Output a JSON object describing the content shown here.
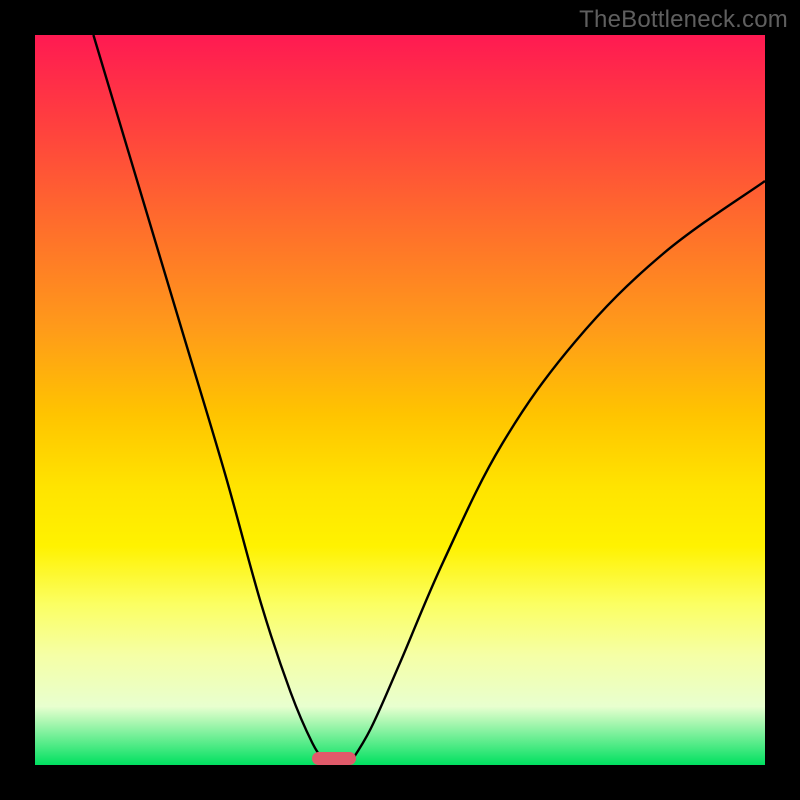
{
  "watermark": "TheBottleneck.com",
  "chart_data": {
    "type": "line",
    "title": "",
    "xlabel": "",
    "ylabel": "",
    "xlim": [
      0,
      100
    ],
    "ylim": [
      0,
      100
    ],
    "grid": false,
    "legend": false,
    "series": [
      {
        "name": "left-branch",
        "x": [
          8,
          14,
          20,
          26,
          31,
          35,
          38,
          40
        ],
        "y": [
          100,
          80,
          60,
          40,
          22,
          10,
          3,
          0
        ]
      },
      {
        "name": "right-branch",
        "x": [
          43,
          46,
          50,
          56,
          64,
          74,
          86,
          100
        ],
        "y": [
          0,
          5,
          14,
          28,
          44,
          58,
          70,
          80
        ]
      }
    ],
    "marker": {
      "x": 41,
      "y": 0,
      "width_frac": 0.06,
      "height_frac": 0.018,
      "color": "#e05a6a"
    },
    "background_gradient": [
      "#ff1a52",
      "#ff3f3f",
      "#ff6a2d",
      "#ff9a1a",
      "#ffc400",
      "#ffe400",
      "#fff200",
      "#fbff63",
      "#f5ffa6",
      "#e8ffcf",
      "#00e060"
    ]
  },
  "plot_geometry": {
    "inner_left": 35,
    "inner_top": 35,
    "inner_width": 730,
    "inner_height": 730
  }
}
